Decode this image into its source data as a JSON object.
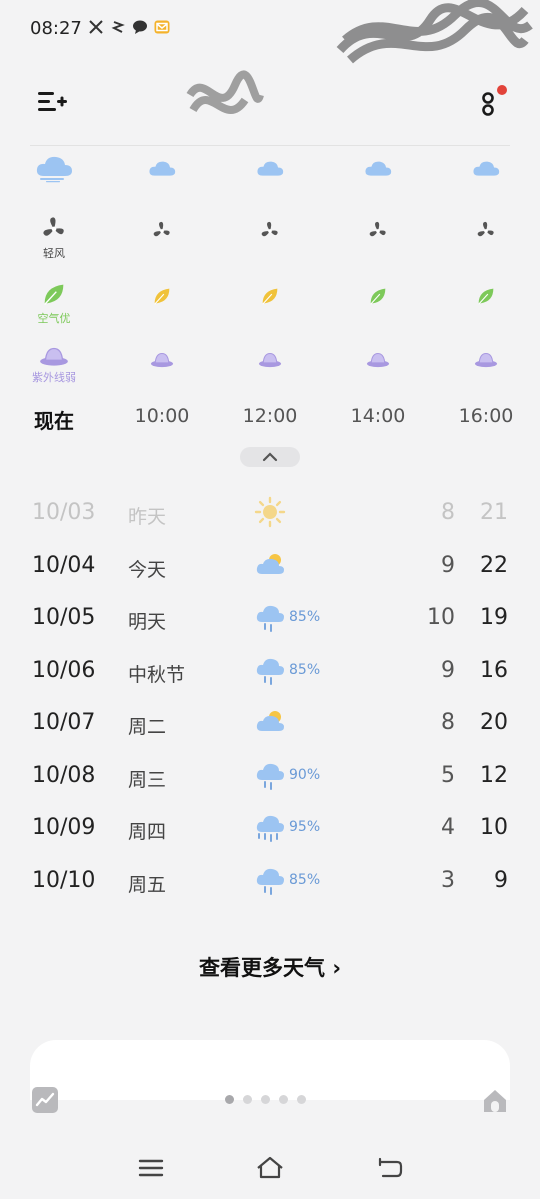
{
  "status_bar": {
    "time": "08:27",
    "icons": [
      "x-app-icon",
      "signal-app-icon",
      "chat-bubble-icon",
      "mail-notification-icon"
    ]
  },
  "header": {
    "menu_icon": "add-city-menu-icon",
    "more_icon": "more-options-icon",
    "notification_dot_color": "#e2433a"
  },
  "hourly": {
    "weather_icons": [
      "fog-cloud",
      "cloud",
      "cloud",
      "cloud",
      "cloud"
    ],
    "wind": {
      "first_label": "轻风",
      "icon": "fan-icon"
    },
    "air": {
      "first_label": "空气优",
      "first_color": "#7dc95a",
      "colors": [
        "#7dc95a",
        "#f0c23a",
        "#f0c23a",
        "#7dc95a",
        "#7dc95a"
      ]
    },
    "uv": {
      "first_label": "紫外线弱",
      "color": "#a898e0"
    },
    "times": [
      "现在",
      "10:00",
      "12:00",
      "14:00",
      "16:00"
    ]
  },
  "daily": [
    {
      "date": "10/03",
      "day": "昨天",
      "icon": "sunny",
      "prob": "",
      "low": "8",
      "high": "21",
      "past": true
    },
    {
      "date": "10/04",
      "day": "今天",
      "icon": "partly-cloudy",
      "prob": "",
      "low": "9",
      "high": "22",
      "past": false
    },
    {
      "date": "10/05",
      "day": "明天",
      "icon": "rain",
      "prob": "85%",
      "low": "10",
      "high": "19",
      "past": false
    },
    {
      "date": "10/06",
      "day": "中秋节",
      "icon": "rain",
      "prob": "85%",
      "low": "9",
      "high": "16",
      "past": false
    },
    {
      "date": "10/07",
      "day": "周二",
      "icon": "partly-cloudy",
      "prob": "",
      "low": "8",
      "high": "20",
      "past": false
    },
    {
      "date": "10/08",
      "day": "周三",
      "icon": "rain",
      "prob": "90%",
      "low": "5",
      "high": "12",
      "past": false
    },
    {
      "date": "10/09",
      "day": "周四",
      "icon": "heavy-rain",
      "prob": "95%",
      "low": "4",
      "high": "10",
      "past": false
    },
    {
      "date": "10/10",
      "day": "周五",
      "icon": "rain",
      "prob": "85%",
      "low": "3",
      "high": "9",
      "past": false
    }
  ],
  "more_weather": {
    "label": "查看更多天气 ›"
  },
  "pager": {
    "count": 5,
    "active": 0
  },
  "colors": {
    "cloud": "#9cc4f2",
    "sun": "#f6c545",
    "rain_drop": "#7aa6dd",
    "icon_gray": "#555555"
  }
}
